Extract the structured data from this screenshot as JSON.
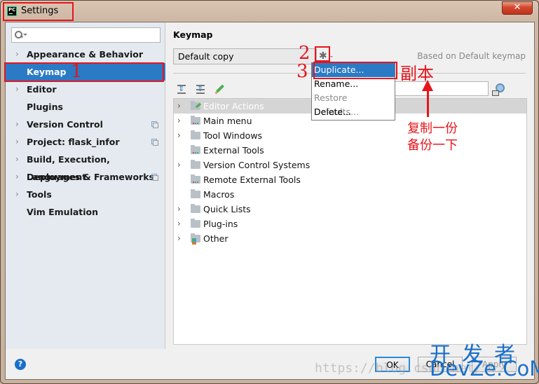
{
  "window": {
    "title": "Settings",
    "app_icon_text": "PC",
    "close_glyph": "✕"
  },
  "sidebar": {
    "search_placeholder": "",
    "items": [
      {
        "label": "Appearance & Behavior",
        "expandable": true,
        "project_icon": false,
        "selected": false
      },
      {
        "label": "Keymap",
        "expandable": false,
        "project_icon": false,
        "selected": true
      },
      {
        "label": "Editor",
        "expandable": true,
        "project_icon": false,
        "selected": false
      },
      {
        "label": "Plugins",
        "expandable": false,
        "project_icon": false,
        "selected": false
      },
      {
        "label": "Version Control",
        "expandable": true,
        "project_icon": true,
        "selected": false
      },
      {
        "label": "Project: flask_infor",
        "expandable": true,
        "project_icon": true,
        "selected": false
      },
      {
        "label": "Build, Execution, Deployment",
        "expandable": true,
        "project_icon": false,
        "selected": false
      },
      {
        "label": "Languages & Frameworks",
        "expandable": true,
        "project_icon": true,
        "selected": false
      },
      {
        "label": "Tools",
        "expandable": true,
        "project_icon": false,
        "selected": false
      },
      {
        "label": "Vim Emulation",
        "expandable": false,
        "project_icon": false,
        "selected": false
      }
    ]
  },
  "main": {
    "heading": "Keymap",
    "keymap_select": "Default copy",
    "based_on": "Based on Default keymap",
    "gear_glyph": "✱",
    "filter_value": "",
    "tree": [
      {
        "label": "Editor Actions",
        "expandable": true,
        "icon": "edit",
        "selected": true
      },
      {
        "label": "Main menu",
        "expandable": true,
        "icon": "dots",
        "selected": false
      },
      {
        "label": "Tool Windows",
        "expandable": true,
        "icon": "plain",
        "selected": false
      },
      {
        "label": "External Tools",
        "expandable": false,
        "icon": "dots",
        "selected": false
      },
      {
        "label": "Version Control Systems",
        "expandable": true,
        "icon": "plain",
        "selected": false
      },
      {
        "label": "Remote External Tools",
        "expandable": false,
        "icon": "dots",
        "selected": false
      },
      {
        "label": "Macros",
        "expandable": false,
        "icon": "plain",
        "selected": false
      },
      {
        "label": "Quick Lists",
        "expandable": true,
        "icon": "plain",
        "selected": false
      },
      {
        "label": "Plug-ins",
        "expandable": true,
        "icon": "plain",
        "selected": false
      },
      {
        "label": "Other",
        "expandable": true,
        "icon": "other",
        "selected": false
      }
    ]
  },
  "popup_menu": {
    "items": [
      {
        "label": "Duplicate...",
        "state": "active"
      },
      {
        "label": "Rename...",
        "state": "normal"
      },
      {
        "label": "Restore Defaults...",
        "state": "disabled"
      },
      {
        "label": "Delete...",
        "state": "normal"
      }
    ]
  },
  "buttons": {
    "help": "?",
    "ok": "OK",
    "cancel": "Cancel",
    "apply": "Apply"
  },
  "annotations": {
    "step1": "1",
    "step2": "2",
    "step3": "3",
    "duplicate_note": "副本",
    "copy_note_line1": "复制一份",
    "copy_note_line2": "备份一下",
    "color": "#e8141c"
  },
  "watermark": {
    "url": "https://blog.csdn.net/...",
    "logo_cn": "开发者",
    "logo_en": "DevZe.CoM"
  },
  "colors": {
    "selection": "#2a7ac6",
    "sidebar_bg": "#e4eaf0",
    "dialog_bg": "#f0f0f0",
    "ok_focus": "#2a8ad8"
  }
}
